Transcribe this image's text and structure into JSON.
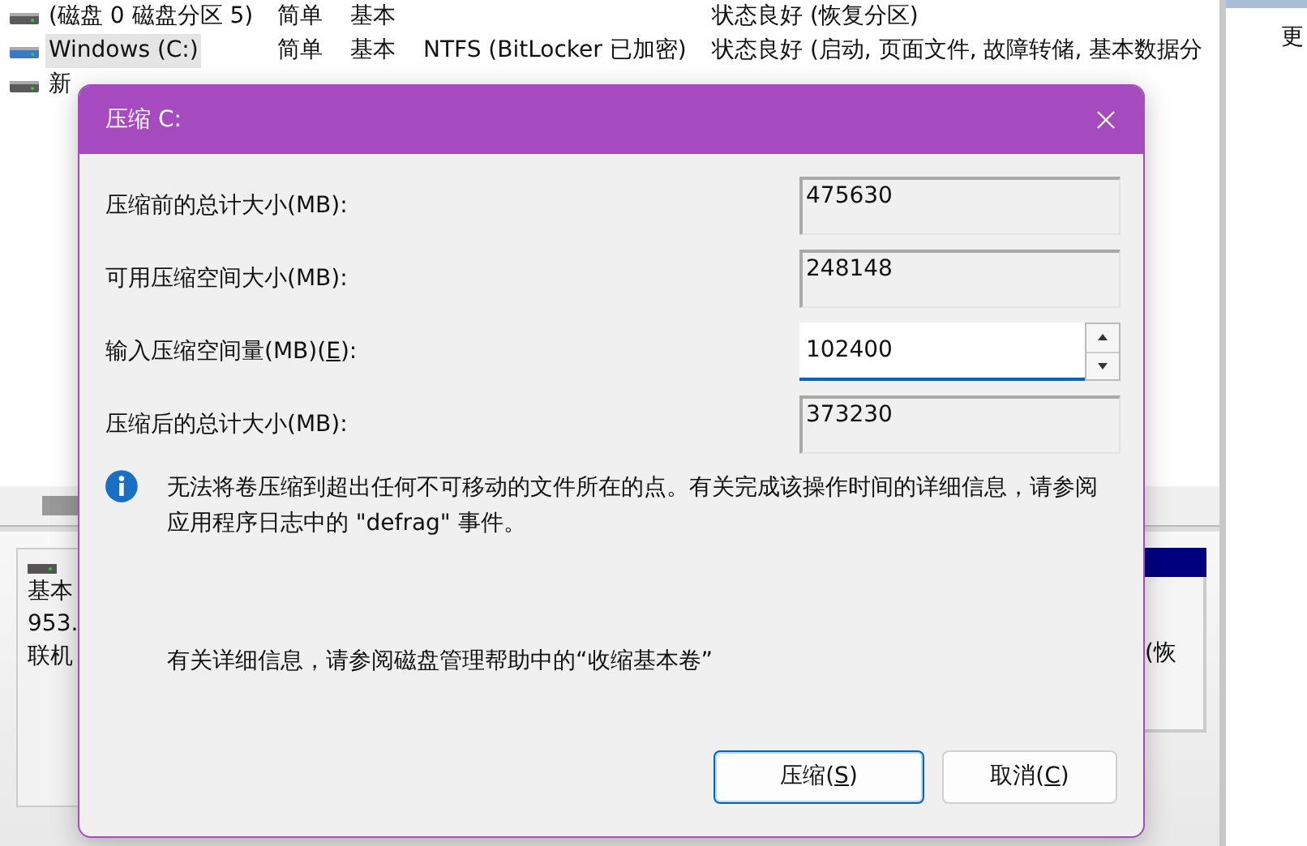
{
  "volume_list": {
    "rows": [
      {
        "kind": "disk",
        "column_1": "(磁盘 0 磁盘分区 5)",
        "column_2": "简单",
        "column_3": "基本",
        "column_5": "状态良好 (恢复分区)",
        "selected": false
      },
      {
        "kind": "system",
        "column_1": "Windows (C:)",
        "column_2": "简单",
        "column_3": "基本",
        "column_4": "NTFS (BitLocker 已加密)",
        "column_5": "状态良好 (启动, 页面文件, 故障转储, 基本数据分",
        "selected": true
      },
      {
        "kind": "disk",
        "column_1": "新",
        "selected": false
      }
    ]
  },
  "side_pane": {
    "text": "更"
  },
  "disk_panel": {
    "lines": [
      "基本",
      "953.",
      "联机"
    ]
  },
  "partition": {
    "text": "(恢"
  },
  "dialog": {
    "title": "压缩 C:",
    "fields": [
      {
        "kind": "readonly",
        "label": "压缩前的总计大小(MB):",
        "value": "475630"
      },
      {
        "kind": "readonly",
        "label": "可用压缩空间大小(MB):",
        "value": "248148"
      },
      {
        "kind": "spin",
        "label_before": "输入压缩空间量(MB)(",
        "access_key": "E",
        "label_after": "):",
        "value": "102400"
      },
      {
        "kind": "readonly",
        "label": "压缩后的总计大小(MB):",
        "value": "373230"
      }
    ],
    "info": "无法将卷压缩到超出任何不可移动的文件所在的点。有关完成该操作时间的详细信息，请参阅应用程序日志中的 \"defrag\" 事件。",
    "help": "有关详细信息，请参阅磁盘管理帮助中的“收缩基本卷”",
    "buttons": [
      {
        "label_before": "压缩(",
        "access_key": "S",
        "label_after": ")",
        "default": true
      },
      {
        "label_before": "取消(",
        "access_key": "C",
        "label_after": ")",
        "default": false
      }
    ]
  }
}
